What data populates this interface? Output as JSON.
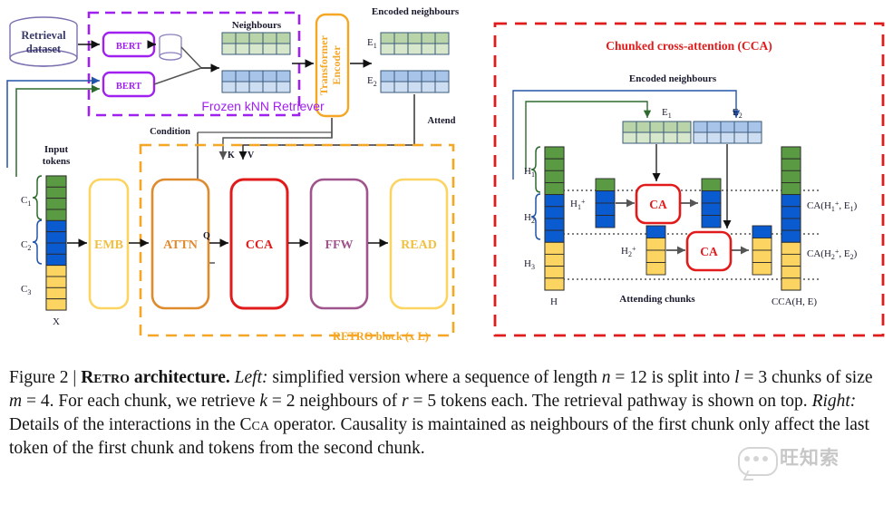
{
  "figure": {
    "caption_prefix": "Figure 2 | ",
    "caption_title": "Retro",
    "caption_title_rest": " architecture.",
    "caption_left_label": "Left:",
    "caption_seg1": " simplified version where a sequence of length ",
    "caption_n": "n",
    "caption_seg2": " = 12 is split into ",
    "caption_l": "l",
    "caption_seg3": " = 3 chunks of size ",
    "caption_m": "m",
    "caption_seg4": " = 4. For each chunk, we retrieve ",
    "caption_k": "k",
    "caption_seg5": " = 2 neighbours of ",
    "caption_r": "r",
    "caption_seg6": " = 5 tokens each. The retrieval pathway is shown on top. ",
    "caption_right_label": "Right:",
    "caption_seg7": " Details of the interactions in the ",
    "caption_cca": "Cca",
    "caption_seg8": " operator. Causality is maintained as neighbours of the first chunk only affect the last token of the first chunk and tokens from the second chunk."
  },
  "left_panel": {
    "retrieval_dataset": "Retrieval\ndataset",
    "retrieval_dataset_line1": "Retrieval",
    "retrieval_dataset_line2": "dataset",
    "bert_top": "BERT",
    "bert_bottom": "BERT",
    "frozen_retriever_label": "Frozen kNN Retriever",
    "neighbours_label": "Neighbours",
    "transformer_encoder_line1": "Transformer",
    "transformer_encoder_line2": "Encoder",
    "encoded_neighbours_label": "Encoded neighbours",
    "e1_label": "E",
    "e1_sub": "1",
    "e2_label": "E",
    "e2_sub": "2",
    "attend_label": "Attend",
    "condition_label": "Condition",
    "input_tokens_line1": "Input",
    "input_tokens_line2": "tokens",
    "chunk1_label": "C",
    "chunk1_sub": "1",
    "chunk2_label": "C",
    "chunk2_sub": "2",
    "chunk3_label": "C",
    "chunk3_sub": "3",
    "x_label": "X",
    "k_label": "K",
    "v_label": "V",
    "q_label": "Q",
    "blocks": {
      "emb": "EMB",
      "attn": "ATTN",
      "cca": "CCA",
      "ffw": "FFW",
      "read": "READ"
    },
    "retro_block_label": "RETRO block (x L)"
  },
  "right_panel": {
    "title": "Chunked cross-attention (CCA)",
    "encoded_neighbours_label": "Encoded neighbours",
    "e1_label": "E",
    "e1_sub": "1",
    "e2_label": "E",
    "e2_sub": "2",
    "h1_label": "H",
    "h1_sub": "1",
    "h2_label": "H",
    "h2_sub": "2",
    "h3_label": "H",
    "h3_sub": "3",
    "h_label": "H",
    "h1plus_label": "H",
    "h1plus_sub": "1",
    "h1plus_sup": "+",
    "h2plus_label": "H",
    "h2plus_sub": "2",
    "h2plus_sup": "+",
    "ca_top": "CA",
    "ca_bottom": "CA",
    "attending_chunks_label": "Attending chunks",
    "out1_label": "CA(H",
    "out1_sub": "1",
    "out1_sup": "+",
    "out1_tail": ", E",
    "out1_tailsub": "1",
    "out1_end": ")",
    "out2_label": "CA(H",
    "out2_sub": "2",
    "out2_sup": "+",
    "out2_tail": ", E",
    "out2_tailsub": "2",
    "out2_end": ")",
    "cca_out_label": "CCA(H, E)"
  },
  "colors": {
    "green": "#5a9a43",
    "green_light": "#b8d4a8",
    "green_pale": "#d6e7cc",
    "blue": "#0a5ad0",
    "blue_light": "#a8c4e8",
    "blue_pale": "#cdddf2",
    "yellow": "#fcd462",
    "purple": "#a020f0",
    "orange": "#f5a623",
    "red": "#e11b1b",
    "mauve": "#a0548c",
    "dark_green": "#2e6b2e",
    "dark_blue": "#2255aa",
    "gray": "#555555",
    "text": "#1a1a2e"
  },
  "watermark": {
    "text": "旺知索"
  }
}
